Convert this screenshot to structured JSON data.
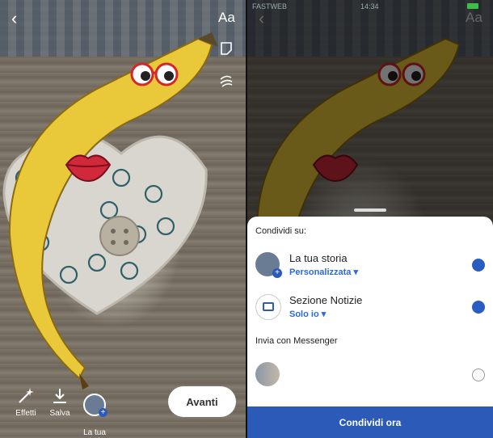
{
  "left_editor": {
    "text_tool_label": "Aa",
    "tools": [
      {
        "label": "Effetti",
        "icon": "magic-wand-icon"
      },
      {
        "label": "Salva",
        "icon": "download-icon"
      },
      {
        "label": "La tua\nstoria",
        "icon": "story-avatar-icon"
      }
    ],
    "next_button": "Avanti"
  },
  "right_share": {
    "status_bar": {
      "carrier": "FASTWEB",
      "time": "14:34"
    },
    "text_tool_label": "Aa",
    "sheet": {
      "heading": "Condividi su:",
      "options": [
        {
          "title": "La tua storia",
          "subtitle": "Personalizzata",
          "checked": true
        },
        {
          "title": "Sezione Notizie",
          "subtitle": "Solo io",
          "checked": true
        }
      ],
      "messenger_heading": "Invia con Messenger",
      "messenger_selected": false,
      "share_button": "Condividi ora"
    }
  },
  "colors": {
    "accent": "#2b5ab8",
    "link": "#2d69d8",
    "banana": "#e9c83a",
    "lips": "#d0293b",
    "glasses": "#d4262b"
  }
}
